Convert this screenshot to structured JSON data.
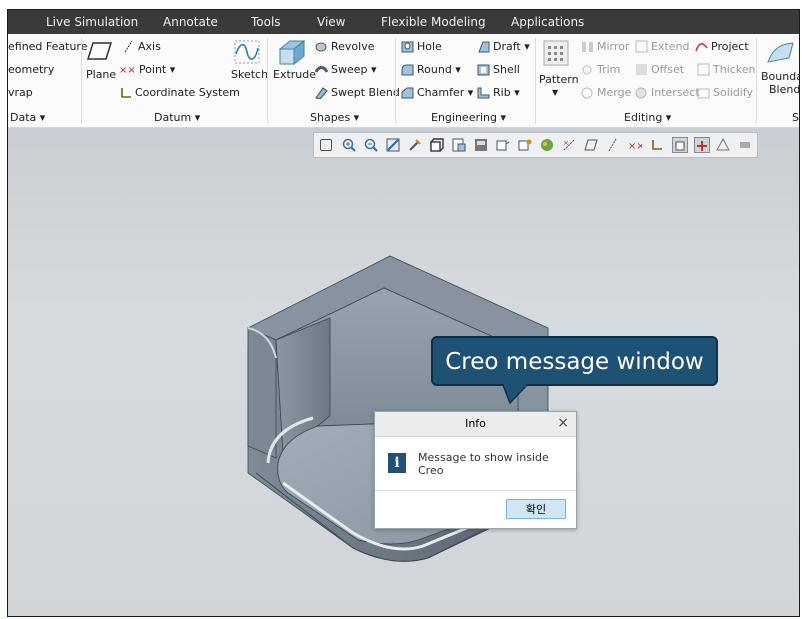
{
  "menu": {
    "live_simulation": "Live Simulation",
    "annotate": "Annotate",
    "tools": "Tools",
    "view": "View",
    "flexible_modeling": "Flexible Modeling",
    "applications": "Applications"
  },
  "ribbon": {
    "get_data": {
      "defined_feature": "efined Feature",
      "geometry": "eometry",
      "wrap": "vrap",
      "group": "Data ▾"
    },
    "datum": {
      "plane": "Plane",
      "axis": "Axis",
      "point": "Point ▾",
      "coordinate_system": "Coordinate System",
      "sketch": "Sketch",
      "group": "Datum ▾"
    },
    "shapes": {
      "extrude": "Extrude",
      "revolve": "Revolve",
      "sweep": "Sweep ▾",
      "swept_blend": "Swept Blend",
      "group": "Shapes ▾"
    },
    "engineering": {
      "hole": "Hole",
      "draft": "Draft ▾",
      "round": "Round ▾",
      "shell": "Shell",
      "chamfer": "Chamfer ▾",
      "rib": "Rib ▾",
      "group": "Engineering ▾"
    },
    "editing": {
      "pattern": "Pattern",
      "mirror": "Mirror",
      "extend": "Extend",
      "project": "Project",
      "trim": "Trim",
      "offset": "Offset",
      "thicken": "Thicken",
      "merge": "Merge",
      "intersect": "Intersect",
      "solidify": "Solidify",
      "group": "Editing ▾"
    },
    "surfaces": {
      "boundary_1": "Bounda",
      "boundary_2": "Blend",
      "group": "S"
    }
  },
  "callout": {
    "text": "Creo message window"
  },
  "dialog": {
    "title": "Info",
    "close": "×",
    "icon_letter": "i",
    "message": "Message to show inside Creo",
    "ok": "확인"
  },
  "colors": {
    "menubar": "#3a3a3a",
    "callout": "#1e5275",
    "viewport": "#cdd3d8",
    "part": "#8a97a3",
    "dialog_button": "#cfe6f5"
  }
}
